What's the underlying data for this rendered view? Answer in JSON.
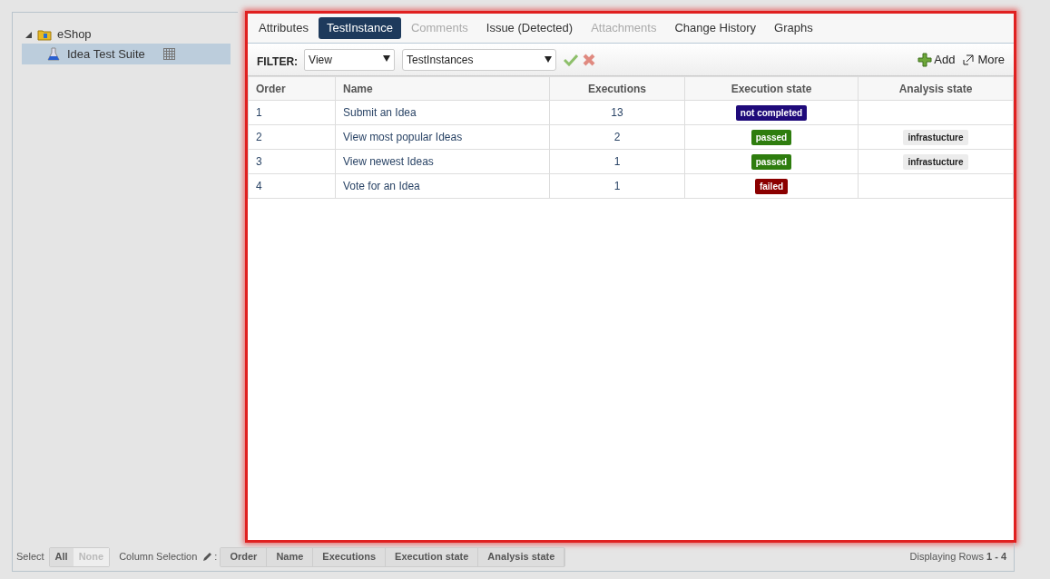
{
  "tree": {
    "label": "eShop",
    "expanded": true,
    "children": [
      {
        "label": "Idea Test Suite",
        "selected": true
      }
    ]
  },
  "tabs": [
    {
      "label": "Attributes",
      "selected": false,
      "disabled": false
    },
    {
      "label": "TestInstance",
      "selected": true,
      "disabled": false
    },
    {
      "label": "Comments",
      "selected": false,
      "disabled": true
    },
    {
      "label": "Issue (Detected)",
      "selected": false,
      "disabled": false
    },
    {
      "label": "Attachments",
      "selected": false,
      "disabled": true
    },
    {
      "label": "Change History",
      "selected": false,
      "disabled": false
    },
    {
      "label": "Graphs",
      "selected": false,
      "disabled": false
    }
  ],
  "filter": {
    "label": "FILTER:",
    "view": "View",
    "set": "TestInstances"
  },
  "actions": [
    "Add",
    "More"
  ],
  "table": {
    "columns": [
      "Order",
      "Name",
      "Executions",
      "Execution state",
      "Analysis state"
    ],
    "rows": [
      {
        "order": "1",
        "name": "Submit an Idea",
        "executions": "13",
        "execution_state": {
          "text": "not completed",
          "color": "#1f0a7a"
        }
      },
      {
        "order": "2",
        "name": "View most popular Ideas",
        "executions": "2",
        "execution_state": {
          "text": "passed",
          "color": "#2e7d0e"
        },
        "analysis_state": "infrastucture"
      },
      {
        "order": "3",
        "name": "View newest Ideas",
        "executions": "1",
        "execution_state": {
          "text": "passed",
          "color": "#2e7d0e"
        },
        "analysis_state": "infrastucture"
      },
      {
        "order": "4",
        "name": "Vote for an Idea",
        "executions": "1",
        "execution_state": {
          "text": "failed",
          "color": "#8b0000"
        }
      }
    ]
  },
  "footer": {
    "select_label": "Select",
    "select_buttons": [
      {
        "label": "All",
        "disabled": false
      },
      {
        "label": "None",
        "disabled": true
      }
    ],
    "column_selection_label": "Column Selection",
    "colon": ":",
    "column_buttons": [
      "Order",
      "Name",
      "Executions",
      "Execution state",
      "Analysis state"
    ],
    "displaying": "Displaying Rows **1 - 4**"
  }
}
